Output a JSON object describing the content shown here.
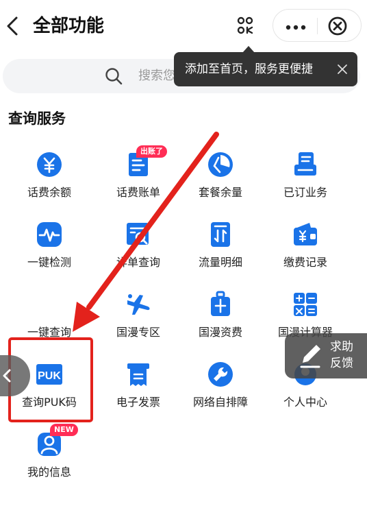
{
  "header": {
    "title": "全部功能",
    "back_icon": "chevron-left-icon",
    "scan_icon": "scan-icon",
    "more_icon": "more-dots-icon",
    "close_icon": "close-circle-icon"
  },
  "search": {
    "placeholder": "搜索您"
  },
  "tooltip": {
    "text": "添加至首页，服务更便捷",
    "close_icon": "close-icon"
  },
  "section": {
    "title": "查询服务"
  },
  "items": [
    {
      "label": "话费余额",
      "icon": "yuan-coin-icon"
    },
    {
      "label": "话费账单",
      "icon": "bill-document-icon",
      "badge": "出账了"
    },
    {
      "label": "套餐余量",
      "icon": "pie-chart-icon"
    },
    {
      "label": "已订业务",
      "icon": "subscribed-service-icon"
    },
    {
      "label": "一键检测",
      "icon": "pulse-check-icon"
    },
    {
      "label": "详单查询",
      "icon": "detail-search-icon"
    },
    {
      "label": "流量明细",
      "icon": "data-traffic-icon"
    },
    {
      "label": "缴费记录",
      "icon": "payment-wallet-icon"
    },
    {
      "label": "一键查询",
      "icon": "one-click-query-icon"
    },
    {
      "label": "国漫专区",
      "icon": "airplane-icon"
    },
    {
      "label": "国漫资费",
      "icon": "luggage-icon"
    },
    {
      "label": "国漫计算器",
      "icon": "calculator-icon"
    },
    {
      "label": "查询PUK码",
      "icon": "puk-icon",
      "icon_text": "PUK"
    },
    {
      "label": "电子发票",
      "icon": "e-invoice-icon"
    },
    {
      "label": "网络自排障",
      "icon": "wrench-icon"
    },
    {
      "label": "个人中心",
      "icon": "user-center-icon"
    },
    {
      "label": "我的信息",
      "icon": "my-info-icon",
      "badge": "NEW"
    }
  ],
  "help": {
    "line1": "求助",
    "line2": "反馈",
    "icon": "pencil-edit-icon"
  },
  "overlay": {
    "handle_icon": "chevron-left-icon",
    "arrow_icon": "red-arrow-icon",
    "highlight_color": "#e3221c"
  },
  "colors": {
    "accent_blue": "#1a73e8",
    "badge_red": "#ff2d55",
    "tooltip_bg": "#333333"
  }
}
